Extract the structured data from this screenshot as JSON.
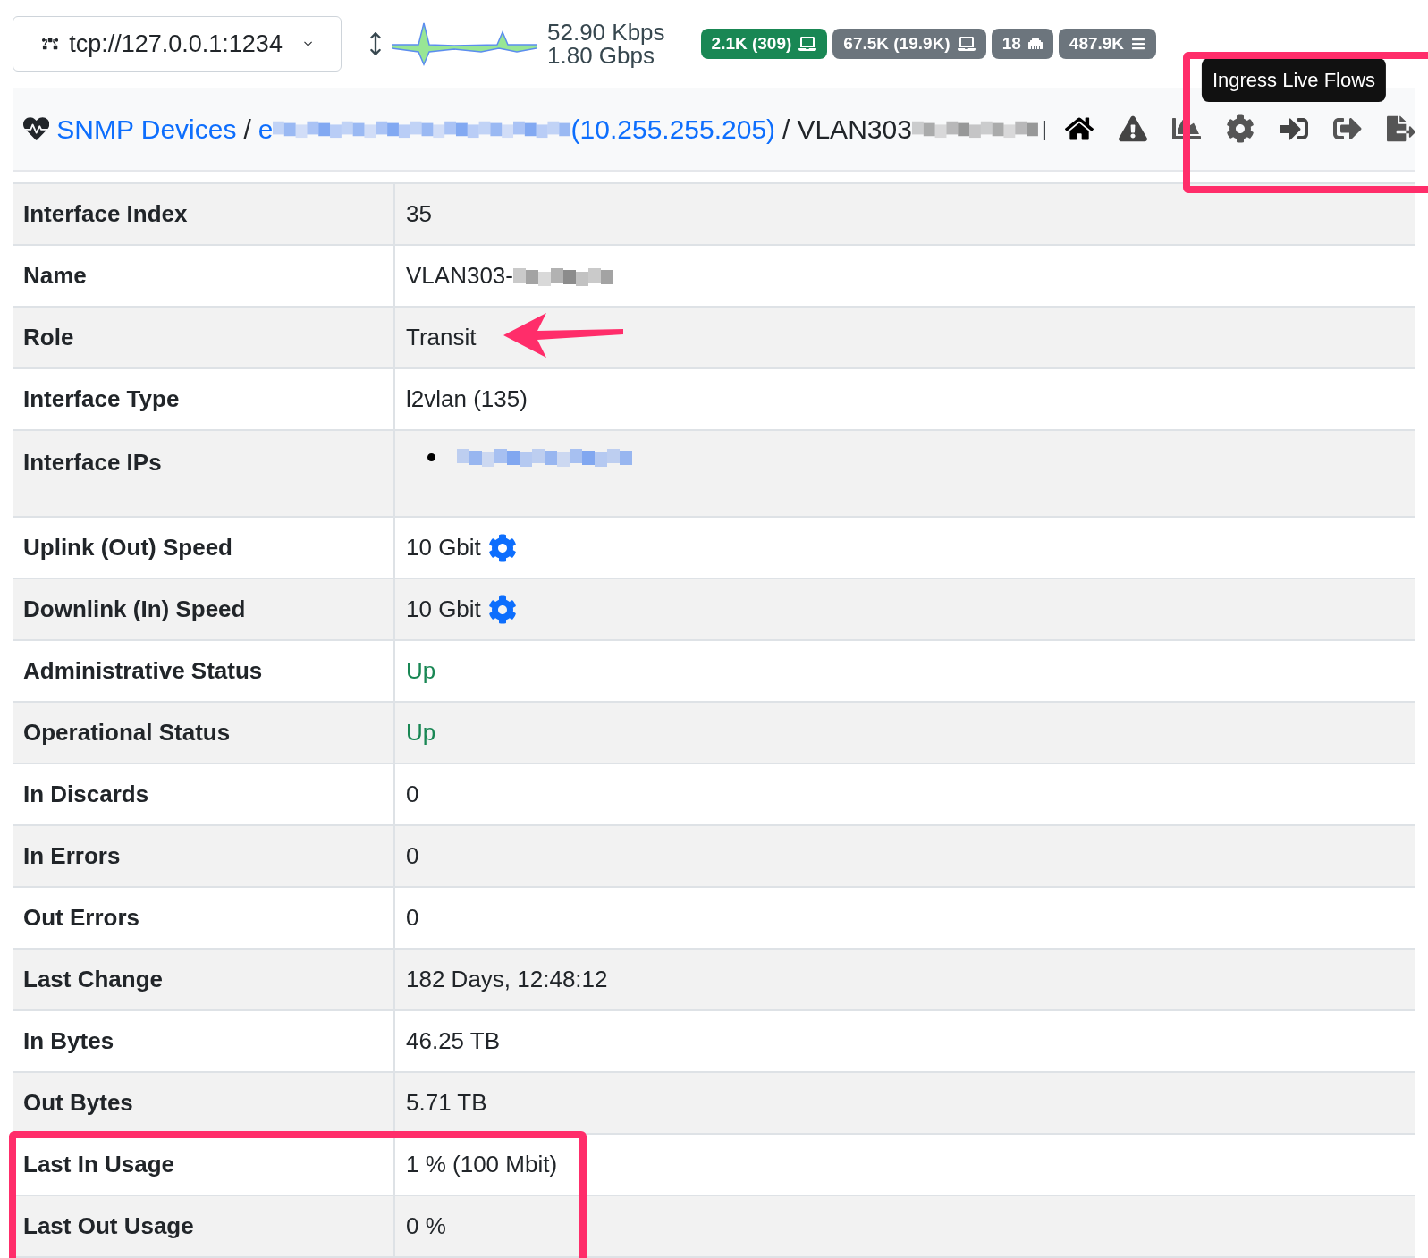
{
  "connection": {
    "label": "tcp://127.0.0.1:1234"
  },
  "throughput": {
    "upload": "52.90 Kbps",
    "download": "1.80 Gbps"
  },
  "badges": [
    {
      "label": "2.1K (309)",
      "color": "#198754",
      "kind": "laptop"
    },
    {
      "label": "67.5K (19.9K)",
      "color": "#6c757d",
      "kind": "laptop"
    },
    {
      "label": "18",
      "color": "#6c757d",
      "kind": "port"
    },
    {
      "label": "487.9K",
      "color": "#6c757d",
      "kind": "list"
    }
  ],
  "breadcrumb": {
    "root": "SNMP Devices",
    "separator": "/",
    "device_prefix": "e",
    "device_ip": "(10.255.255.205)",
    "interface": "VLAN303",
    "divider": "|"
  },
  "toolbar": [
    {
      "kind": "home"
    },
    {
      "kind": "alert"
    },
    {
      "kind": "chart"
    },
    {
      "kind": "settings"
    },
    {
      "kind": "ingress",
      "tooltip": "Ingress Live Flows"
    },
    {
      "kind": "egress"
    },
    {
      "kind": "export"
    }
  ],
  "rows": [
    {
      "label": "Interface Index",
      "value": "35",
      "kind": "text"
    },
    {
      "label": "Name",
      "value": "VLAN303-",
      "kind": "redacted"
    },
    {
      "label": "Role",
      "value": "Transit",
      "kind": "text"
    },
    {
      "label": "Interface Type",
      "value": "l2vlan (135)",
      "kind": "text"
    },
    {
      "label": "Interface IPs",
      "kind": "ip_list"
    },
    {
      "label": "Uplink (Out) Speed",
      "value": "10 Gbit",
      "kind": "speed"
    },
    {
      "label": "Downlink (In) Speed",
      "value": "10 Gbit",
      "kind": "speed"
    },
    {
      "label": "Administrative Status",
      "value": "Up",
      "kind": "status"
    },
    {
      "label": "Operational Status",
      "value": "Up",
      "kind": "status"
    },
    {
      "label": "In Discards",
      "value": "0",
      "kind": "text"
    },
    {
      "label": "In Errors",
      "value": "0",
      "kind": "text"
    },
    {
      "label": "Out Errors",
      "value": "0",
      "kind": "text"
    },
    {
      "label": "Last Change",
      "value": "182 Days, 12:48:12",
      "kind": "text"
    },
    {
      "label": "In Bytes",
      "value": "46.25 TB",
      "kind": "text"
    },
    {
      "label": "Out Bytes",
      "value": "5.71 TB",
      "kind": "text"
    },
    {
      "label": "Last In Usage",
      "value": "1 % (100 Mbit)",
      "kind": "text"
    },
    {
      "label": "Last Out Usage",
      "value": "0 %",
      "kind": "text"
    }
  ]
}
